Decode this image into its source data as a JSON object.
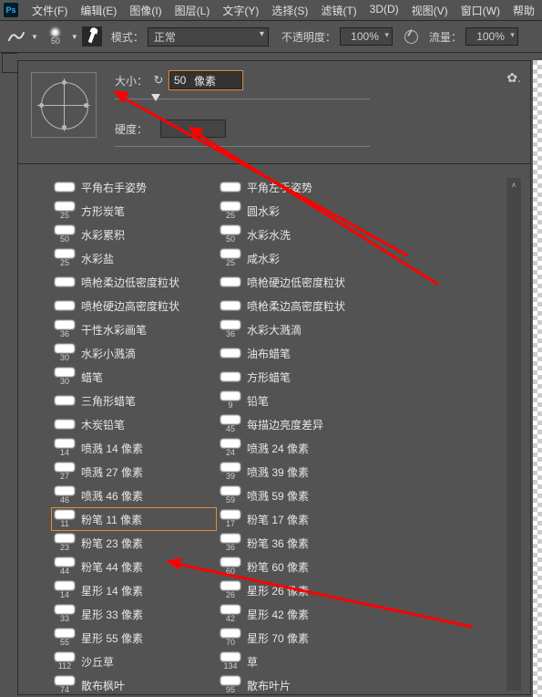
{
  "menubar": {
    "items": [
      "文件(F)",
      "编辑(E)",
      "图像(I)",
      "图层(L)",
      "文字(Y)",
      "选择(S)",
      "滤镜(T)",
      "3D(D)",
      "视图(V)",
      "窗口(W)",
      "帮助"
    ]
  },
  "toolbar": {
    "preset_size": "50",
    "mode_label": "模式：",
    "mode_value": "正常",
    "opacity_label": "不透明度：",
    "opacity_value": "100%",
    "flow_label": "流量：",
    "flow_value": "100%"
  },
  "panel": {
    "size_label": "大小：",
    "size_value": "50",
    "size_unit": "像素",
    "hardness_label": "硬度："
  },
  "brushes": [
    {
      "n": "",
      "label": "平角右手姿势"
    },
    {
      "n": "",
      "label": "平角左手姿势"
    },
    {
      "n": "25",
      "label": "方形炭笔"
    },
    {
      "n": "25",
      "label": "圆水彩"
    },
    {
      "n": "50",
      "label": "水彩累积"
    },
    {
      "n": "50",
      "label": "水彩水洗"
    },
    {
      "n": "25",
      "label": "水彩盐"
    },
    {
      "n": "25",
      "label": "咸水彩"
    },
    {
      "n": "",
      "label": "喷枪柔边低密度粒状"
    },
    {
      "n": "",
      "label": "喷枪硬边低密度粒状"
    },
    {
      "n": "",
      "label": "喷枪硬边高密度粒状"
    },
    {
      "n": "",
      "label": "喷枪柔边高密度粒状"
    },
    {
      "n": "36",
      "label": "干性水彩画笔"
    },
    {
      "n": "36",
      "label": "水彩大溅滴"
    },
    {
      "n": "30",
      "label": "水彩小溅滴"
    },
    {
      "n": "",
      "label": "油布蜡笔"
    },
    {
      "n": "30",
      "label": "蜡笔"
    },
    {
      "n": "",
      "label": "方形蜡笔"
    },
    {
      "n": "",
      "label": "三角形蜡笔"
    },
    {
      "n": "9",
      "label": "铅笔"
    },
    {
      "n": "",
      "label": "木炭铅笔"
    },
    {
      "n": "45",
      "label": "每描边亮度差异"
    },
    {
      "n": "14",
      "label": "喷溅 14 像素"
    },
    {
      "n": "24",
      "label": "喷溅 24 像素"
    },
    {
      "n": "27",
      "label": "喷溅 27 像素"
    },
    {
      "n": "39",
      "label": "喷溅 39 像素"
    },
    {
      "n": "46",
      "label": "喷溅 46 像素"
    },
    {
      "n": "59",
      "label": "喷溅 59 像素"
    },
    {
      "n": "11",
      "label": "粉笔 11 像素",
      "sel": true
    },
    {
      "n": "17",
      "label": "粉笔 17 像素"
    },
    {
      "n": "23",
      "label": "粉笔 23 像素"
    },
    {
      "n": "36",
      "label": "粉笔 36 像素"
    },
    {
      "n": "44",
      "label": "粉笔 44 像素"
    },
    {
      "n": "60",
      "label": "粉笔 60 像素"
    },
    {
      "n": "14",
      "label": "星形 14 像素"
    },
    {
      "n": "26",
      "label": "星形 26 像素"
    },
    {
      "n": "33",
      "label": "星形 33 像素"
    },
    {
      "n": "42",
      "label": "星形 42 像素"
    },
    {
      "n": "55",
      "label": "星形 55 像素"
    },
    {
      "n": "70",
      "label": "星形 70 像素"
    },
    {
      "n": "112",
      "label": "沙丘草"
    },
    {
      "n": "134",
      "label": "草"
    },
    {
      "n": "74",
      "label": "散布枫叶"
    },
    {
      "n": "95",
      "label": "散布叶片"
    }
  ]
}
